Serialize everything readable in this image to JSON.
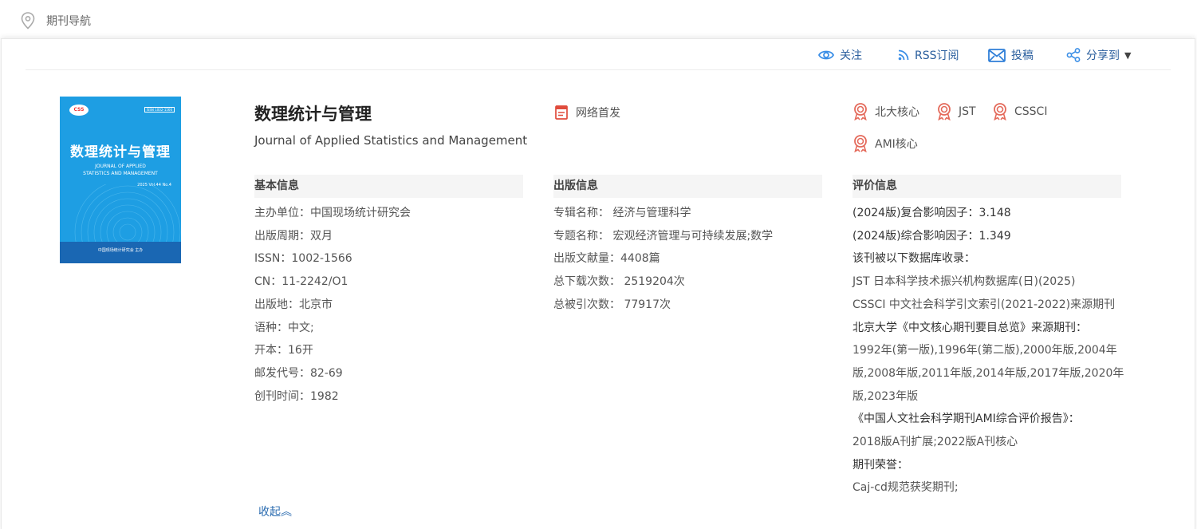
{
  "breadcrumb": {
    "icon": "location-pin-icon",
    "label": "期刊导航"
  },
  "toolbar": {
    "follow": "关注",
    "rss": "RSS订阅",
    "submit": "投稿",
    "share": "分享到"
  },
  "cover": {
    "logo": "CSS",
    "issn": "ISSN 1002-1566",
    "title": "数理统计与管理",
    "en_line1": "JOURNAL OF APPLIED",
    "en_line2": "STATISTICS AND MANAGEMENT",
    "vol": "2025 Vol.44 No.4",
    "publisher": "中国现场统计研究会 主办"
  },
  "journal": {
    "title": "数理统计与管理",
    "english_title": "Journal of Applied Statistics and Management",
    "network_first": "网络首发"
  },
  "badges": [
    "北大核心",
    "JST",
    "CSSCI",
    "AMI核心"
  ],
  "basic": {
    "heading": "基本信息",
    "lines": [
      "主办单位：中国现场统计研究会",
      "出版周期：双月",
      "ISSN：1002-1566",
      "CN：11-2242/O1",
      "出版地：北京市",
      "语种：中文;",
      "开本：16开",
      "邮发代号：82-69",
      "创刊时间：1982"
    ]
  },
  "publication": {
    "heading": "出版信息",
    "lines": [
      "专辑名称： 经济与管理科学",
      "专题名称： 宏观经济管理与可持续发展;数学",
      "出版文献量：4408篇",
      "总下载次数： 2519204次",
      "总被引次数： 77917次"
    ]
  },
  "evaluation": {
    "heading": "评价信息",
    "lines": [
      "(2024版)复合影响因子：3.148",
      "(2024版)综合影响因子：1.349",
      "该刊被以下数据库收录：",
      "JST 日本科学技术振兴机构数据库(日)(2025)",
      "CSSCI 中文社会科学引文索引(2021-2022)来源期刊",
      "北京大学《中文核心期刊要目总览》来源期刊：",
      "1992年(第一版),1996年(第二版),2000年版,2004年",
      "版,2008年版,2011年版,2014年版,2017年版,2020年",
      "版,2023年版",
      "《中国人文社会科学期刊AMI综合评价报告》：",
      "2018版A刊扩展;2022版A刊核心",
      "期刊荣誉：",
      "Caj-cd规范获奖期刊;"
    ]
  },
  "collapse_label": "收起︽",
  "colors": {
    "accent": "#2b5f9e",
    "badge": "#e46a5b",
    "cover": "#1e9ee3"
  }
}
